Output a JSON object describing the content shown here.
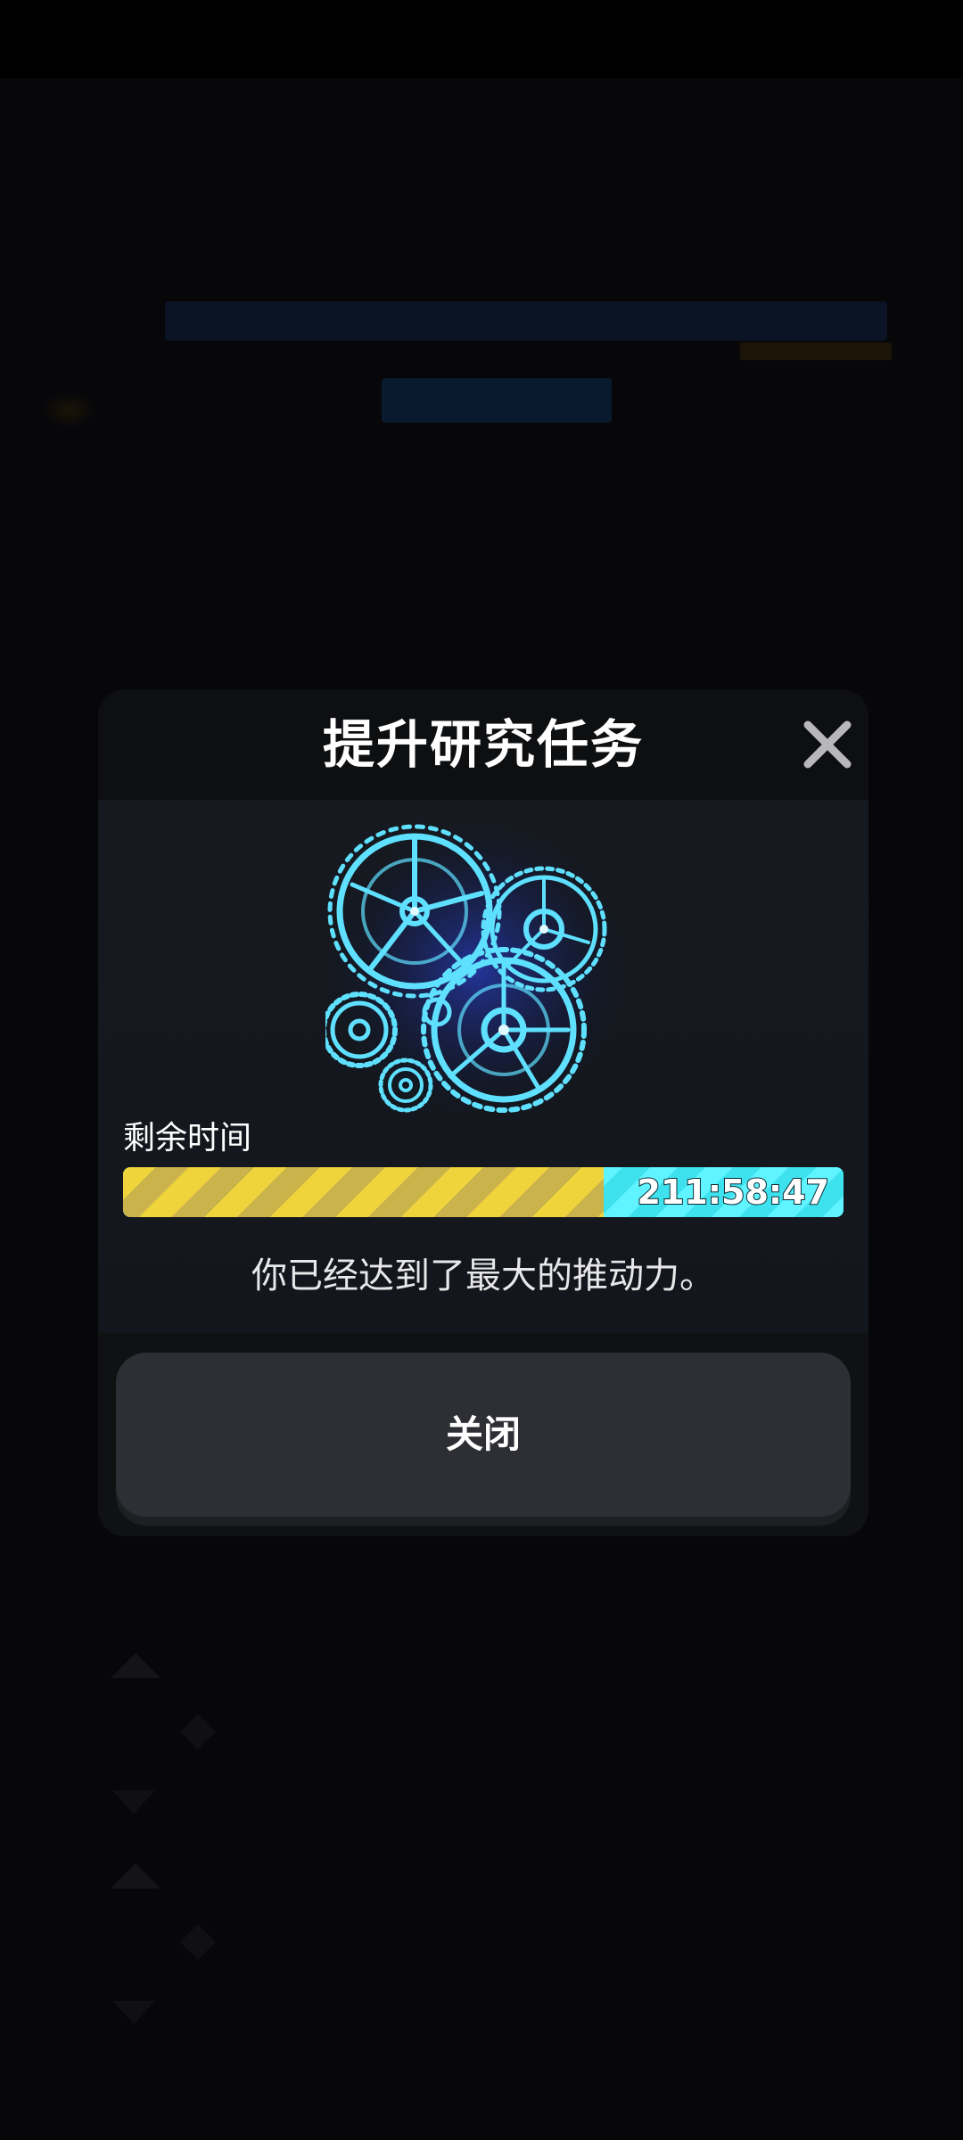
{
  "dialog": {
    "title": "提升研究任务",
    "remaining_time_label": "剩余时间",
    "timer": "211:58:47",
    "progress_fraction": 0.667,
    "message": "你已经达到了最大的推动力。",
    "close_button_label": "关闭"
  },
  "icons": {
    "close": "close-x-icon",
    "illustration": "gears-icon"
  },
  "colors": {
    "progress_fill": "#f0d43c",
    "progress_track": "#3de2ee",
    "gear_glow": "#4fd6ff",
    "dialog_bg": "#101113",
    "button_bg": "#2e2f34"
  }
}
